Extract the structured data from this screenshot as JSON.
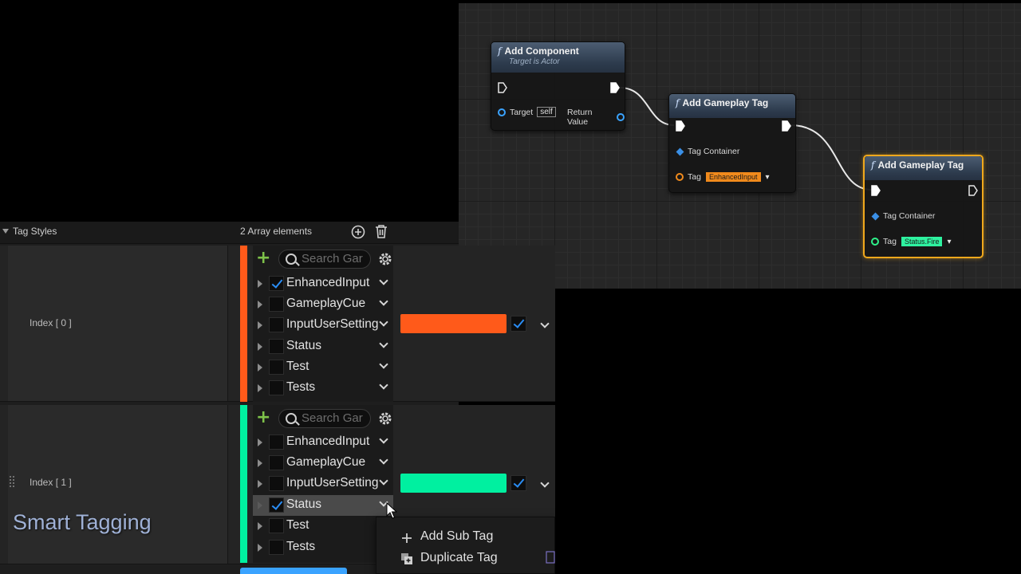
{
  "graph": {
    "nodes": {
      "add_component": {
        "title": "Add Component",
        "subtitle": "Target is Actor",
        "target_label": "Target",
        "target_value": "self",
        "return_label": "Return Value"
      },
      "add_tag_1": {
        "title": "Add Gameplay Tag",
        "container_label": "Tag Container",
        "tag_label": "Tag",
        "tag_value": "EnhancedInput",
        "tag_color": "#f08a1c"
      },
      "add_tag_2": {
        "title": "Add Gameplay Tag",
        "container_label": "Tag Container",
        "tag_label": "Tag",
        "tag_value": "Status.Fire",
        "tag_color": "#2ef2a0"
      }
    },
    "function_glyph": "f"
  },
  "panel": {
    "section_title": "Tag Styles",
    "array_count": "2 Array elements",
    "rows": [
      {
        "index_label": "Index [ 0 ]",
        "color": "#ff5a1a",
        "search_placeholder": "Search Gar",
        "tags": [
          {
            "name": "EnhancedInput",
            "checked": true
          },
          {
            "name": "GameplayCue",
            "checked": false
          },
          {
            "name": "InputUserSetting",
            "checked": false
          },
          {
            "name": "Status",
            "checked": false
          },
          {
            "name": "Test",
            "checked": false
          },
          {
            "name": "Tests",
            "checked": false
          }
        ]
      },
      {
        "index_label": "Index [ 1 ]",
        "color": "#00f0a0",
        "search_placeholder": "Search Gar",
        "tags": [
          {
            "name": "EnhancedInput",
            "checked": false
          },
          {
            "name": "GameplayCue",
            "checked": false
          },
          {
            "name": "InputUserSetting",
            "checked": false
          },
          {
            "name": "Status",
            "checked": true
          },
          {
            "name": "Test",
            "checked": false
          },
          {
            "name": "Tests",
            "checked": false
          }
        ]
      }
    ]
  },
  "context_menu": {
    "items": [
      {
        "label": "Add Sub Tag",
        "icon": "plus-icon"
      },
      {
        "label": "Duplicate Tag",
        "icon": "duplicate-icon"
      }
    ]
  },
  "watermark": "Smart Tagging"
}
